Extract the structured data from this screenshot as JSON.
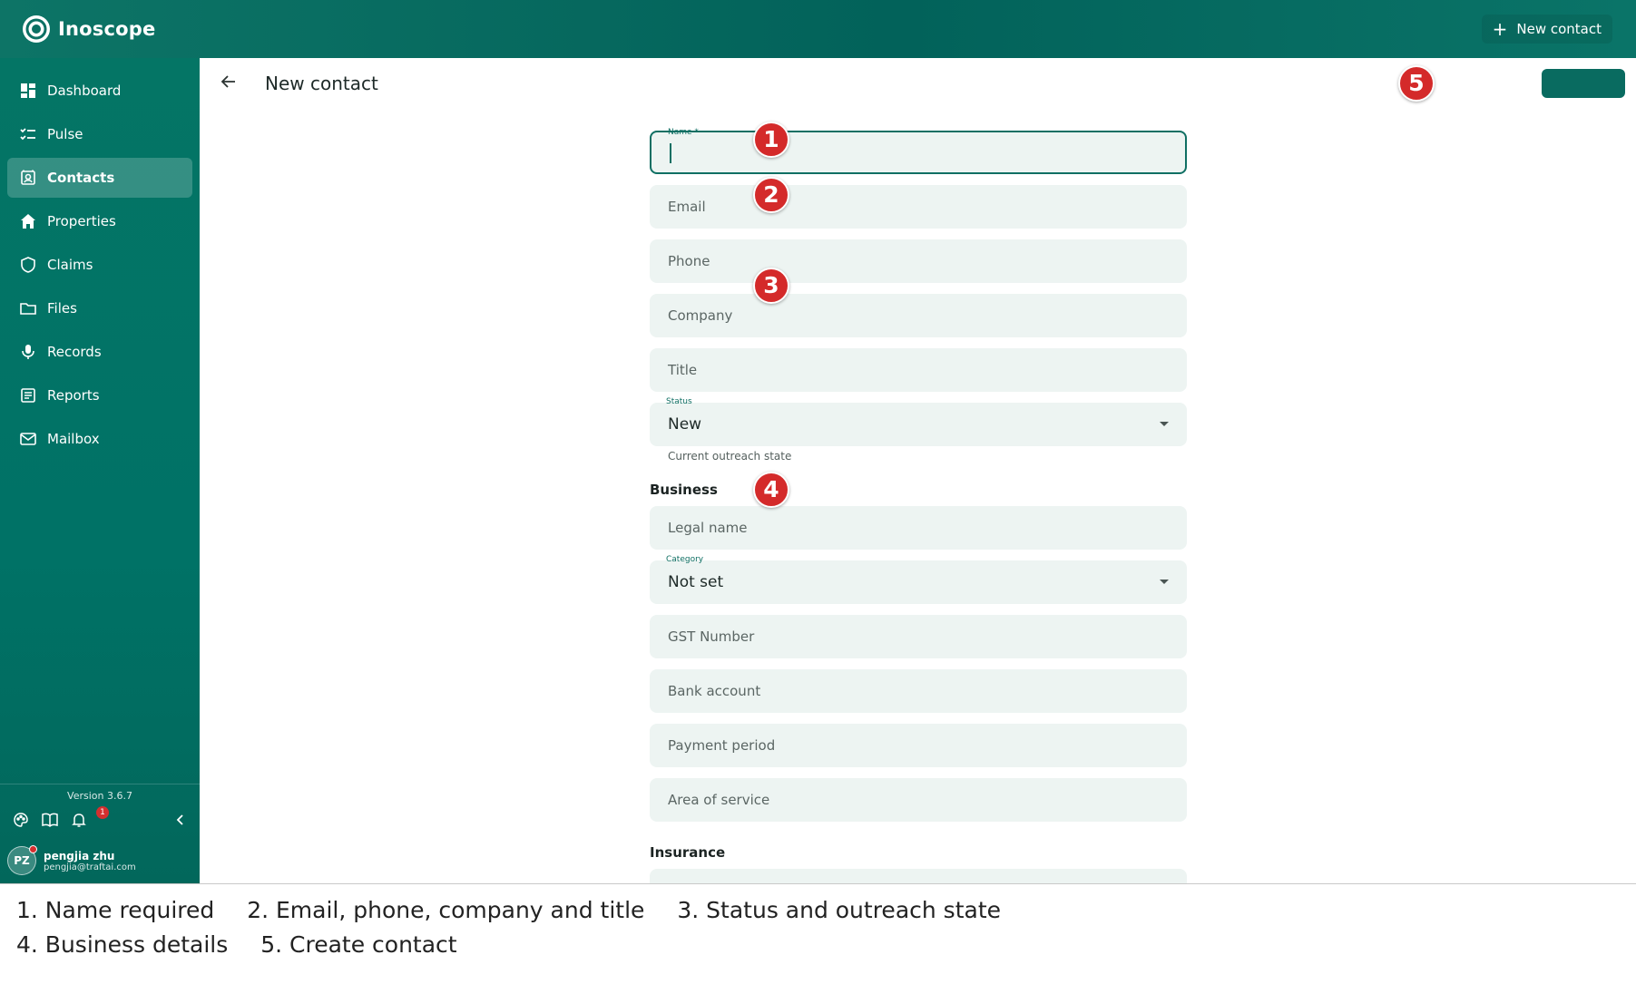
{
  "app": {
    "name": "Inoscope",
    "new_contact_label": "New contact",
    "accent": "#0b6f63"
  },
  "sidebar": {
    "items": [
      {
        "label": "Dashboard",
        "icon": "dashboard-icon"
      },
      {
        "label": "Pulse",
        "icon": "checklist-icon"
      },
      {
        "label": "Contacts",
        "icon": "contacts-icon",
        "active": true
      },
      {
        "label": "Properties",
        "icon": "home-icon"
      },
      {
        "label": "Claims",
        "icon": "shield-icon"
      },
      {
        "label": "Files",
        "icon": "folder-icon"
      },
      {
        "label": "Records",
        "icon": "microphone-icon"
      },
      {
        "label": "Reports",
        "icon": "report-icon"
      },
      {
        "label": "Mailbox",
        "icon": "mail-icon"
      }
    ],
    "version": "Version 3.6.7",
    "notification_count": "1",
    "user": {
      "initials": "PZ",
      "name": "pengjia zhu",
      "email": "pengjia@traftai.com"
    }
  },
  "page": {
    "title": "New contact"
  },
  "form": {
    "name_label": "Name *",
    "email_placeholder": "Email",
    "phone_placeholder": "Phone",
    "company_placeholder": "Company",
    "title_placeholder": "Title",
    "status_label": "Status",
    "status_value": "New",
    "status_helper": "Current outreach state",
    "business_heading": "Business",
    "legal_name_placeholder": "Legal name",
    "category_label": "Category",
    "category_value": "Not set",
    "gst_placeholder": "GST Number",
    "bank_placeholder": "Bank account",
    "payment_placeholder": "Payment period",
    "area_placeholder": "Area of service",
    "insurance_heading": "Insurance"
  },
  "markers": [
    "1",
    "2",
    "3",
    "4",
    "5"
  ],
  "caption": {
    "line1": [
      "1. Name required",
      "2. Email, phone, company and title",
      "3. Status and outreach state"
    ],
    "line2": [
      "4. Business details",
      "5. Create contact"
    ]
  }
}
